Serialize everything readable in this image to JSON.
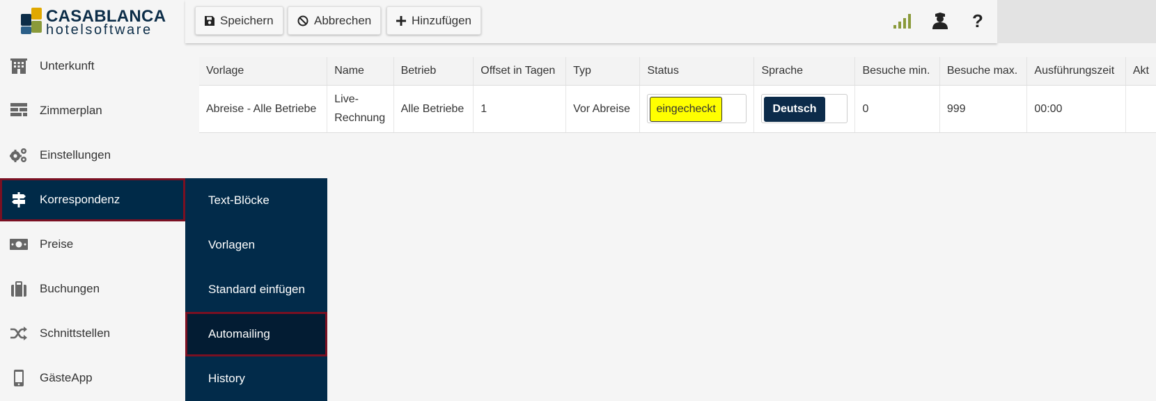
{
  "logo": {
    "line1": "CASABLANCA",
    "line2": "hotelsoftware",
    "colors": [
      "#e0a800",
      "#0c2d48",
      "#2b5f88",
      "#8a9a3a"
    ]
  },
  "sidebar": {
    "items": [
      {
        "label": "Unterkunft",
        "icon": "building-icon"
      },
      {
        "label": "Zimmerplan",
        "icon": "room-plan-icon"
      },
      {
        "label": "Einstellungen",
        "icon": "gears-icon"
      },
      {
        "label": "Korrespondenz",
        "icon": "signpost-icon",
        "active": true
      },
      {
        "label": "Preise",
        "icon": "money-icon"
      },
      {
        "label": "Buchungen",
        "icon": "suitcase-icon"
      },
      {
        "label": "Schnittstellen",
        "icon": "shuffle-icon"
      },
      {
        "label": "GästeApp",
        "icon": "mobile-icon"
      }
    ]
  },
  "submenu": {
    "items": [
      {
        "label": "Text-Blöcke"
      },
      {
        "label": "Vorlagen"
      },
      {
        "label": "Standard einfügen"
      },
      {
        "label": "Automailing",
        "active": true
      },
      {
        "label": "History"
      }
    ]
  },
  "toolbar": {
    "save_label": "Speichern",
    "cancel_label": "Abbrechen",
    "add_label": "Hinzufügen",
    "icons": [
      "signal-icon",
      "user-icon",
      "help-icon"
    ],
    "help_glyph": "?"
  },
  "table": {
    "columns": [
      "Vorlage",
      "Name",
      "Betrieb",
      "Offset in Tagen",
      "Typ",
      "Status",
      "Sprache",
      "Besuche min.",
      "Besuche max.",
      "Ausführungszeit",
      "Akt"
    ],
    "rows": [
      {
        "vorlage": "Abreise - Alle Betriebe",
        "name_line1": "Live-",
        "name_line2": "Rechnung",
        "betrieb": "Alle Betriebe",
        "offset": "1",
        "typ": "Vor Abreise",
        "status": "eingecheckt",
        "sprache": "Deutsch",
        "besuche_min": "0",
        "besuche_max": "999",
        "zeit": "00:00"
      }
    ]
  },
  "colors": {
    "navy": "#022b4a",
    "active_border": "#7a1022",
    "status_yellow": "#ffff00",
    "signal_green": "#8a9a3a"
  }
}
